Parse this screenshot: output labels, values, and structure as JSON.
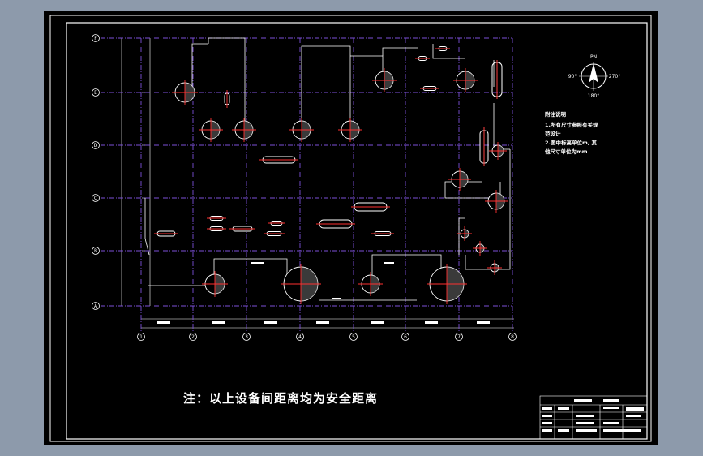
{
  "sheet": {
    "note": "注：以上设备间距离均为安全距离",
    "compass": {
      "north": "PN",
      "west": "90°",
      "east": "270°",
      "south": "180°"
    },
    "legend": {
      "title": "附注说明",
      "lines": [
        "1.所有尺寸参照有关规",
        "范设计",
        "2.图中标高单位m, 其",
        "他尺寸单位为mm"
      ]
    },
    "row_axes": [
      "F",
      "E",
      "D",
      "C",
      "B",
      "A"
    ],
    "col_axes": [
      "1",
      "2",
      "3",
      "4",
      "5",
      "6",
      "7",
      "8"
    ]
  },
  "colors": {
    "background": "#000000",
    "frame": "#ffffff",
    "grid": "#7b4fd8",
    "equipment": "#ff2020",
    "centerline": "#ff4040"
  },
  "icons": [
    "compass-icon",
    "vessel-icon",
    "tank-icon",
    "drum-icon"
  ]
}
